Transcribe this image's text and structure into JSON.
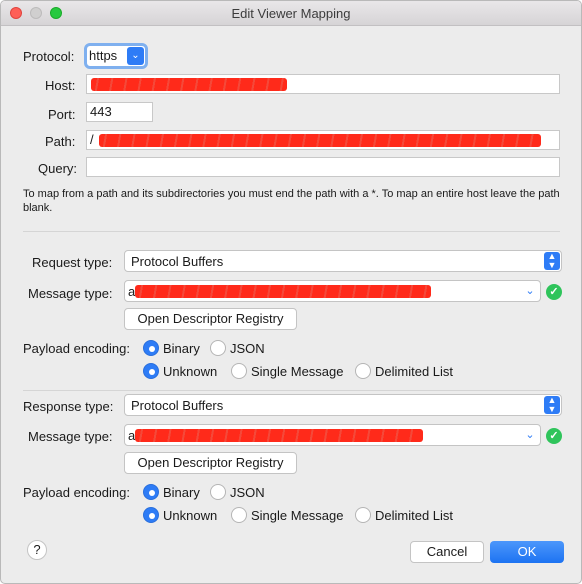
{
  "window": {
    "title": "Edit Viewer Mapping"
  },
  "labels": {
    "protocol": "Protocol:",
    "host": "Host:",
    "port": "Port:",
    "path": "Path:",
    "query": "Query:"
  },
  "fields": {
    "protocol_value": "https",
    "port_value": "443",
    "path_prefix": "/",
    "message_prefix": "a",
    "query_value": ""
  },
  "hint": "To map from a path and its subdirectories you must end the path with a *. To map an entire host leave the path blank.",
  "request": {
    "type_label": "Request type:",
    "type_value": "Protocol Buffers",
    "message_label": "Message type:",
    "open_registry": "Open Descriptor Registry",
    "payload_label": "Payload encoding:",
    "encoding_options": [
      "Binary",
      "JSON"
    ],
    "encoding_selected": "Binary",
    "framing_options": [
      "Unknown",
      "Single Message",
      "Delimited List"
    ],
    "framing_selected": "Unknown"
  },
  "response": {
    "type_label": "Response type:",
    "type_value": "Protocol Buffers",
    "message_label": "Message type:",
    "open_registry": "Open Descriptor Registry",
    "payload_label": "Payload encoding:",
    "encoding_options": [
      "Binary",
      "JSON"
    ],
    "encoding_selected": "Binary",
    "framing_options": [
      "Unknown",
      "Single Message",
      "Delimited List"
    ],
    "framing_selected": "Unknown"
  },
  "footer": {
    "help": "?",
    "cancel": "Cancel",
    "ok": "OK"
  },
  "colors": {
    "accent": "#2e7cf6",
    "redaction": "#ff2a1a",
    "valid": "#2fc45b"
  }
}
